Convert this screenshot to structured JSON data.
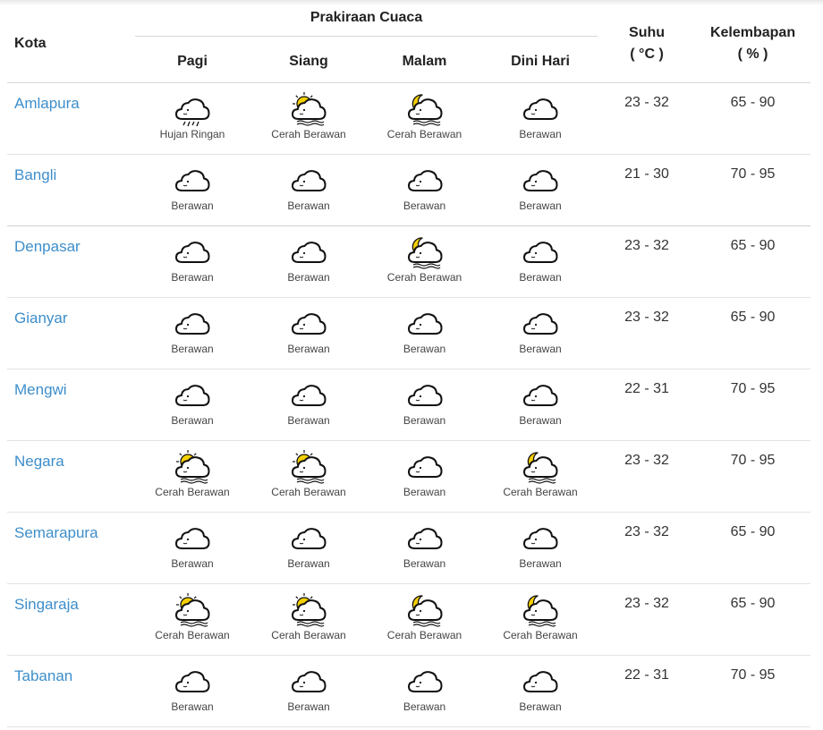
{
  "table": {
    "header": {
      "kota": "Kota",
      "group": "Prakiraan Cuaca",
      "periods": [
        "Pagi",
        "Siang",
        "Malam",
        "Dini Hari"
      ],
      "suhu": "Suhu",
      "suhu_unit": "( °C )",
      "kelembapan": "Kelembapan",
      "kelembapan_unit": "( % )"
    },
    "rows": [
      {
        "city": "Amlapura",
        "weather": [
          {
            "label": "Hujan Ringan",
            "icon": "cloud-rain-icon"
          },
          {
            "label": "Cerah Berawan",
            "icon": "sun-cloud-icon"
          },
          {
            "label": "Cerah Berawan",
            "icon": "moon-cloud-icon"
          },
          {
            "label": "Berawan",
            "icon": "cloud-icon"
          }
        ],
        "suhu": "23 - 32",
        "kelembapan": "65 - 90"
      },
      {
        "city": "Bangli",
        "weather": [
          {
            "label": "Berawan",
            "icon": "cloud-icon"
          },
          {
            "label": "Berawan",
            "icon": "cloud-icon"
          },
          {
            "label": "Berawan",
            "icon": "cloud-icon"
          },
          {
            "label": "Berawan",
            "icon": "cloud-icon"
          }
        ],
        "suhu": "21 - 30",
        "kelembapan": "70 - 95"
      },
      {
        "city": "Denpasar",
        "weather": [
          {
            "label": "Berawan",
            "icon": "cloud-icon"
          },
          {
            "label": "Berawan",
            "icon": "cloud-icon"
          },
          {
            "label": "Cerah Berawan",
            "icon": "moon-cloud-icon"
          },
          {
            "label": "Berawan",
            "icon": "cloud-icon"
          }
        ],
        "suhu": "23 - 32",
        "kelembapan": "65 - 90"
      },
      {
        "city": "Gianyar",
        "weather": [
          {
            "label": "Berawan",
            "icon": "cloud-icon"
          },
          {
            "label": "Berawan",
            "icon": "cloud-icon"
          },
          {
            "label": "Berawan",
            "icon": "cloud-icon"
          },
          {
            "label": "Berawan",
            "icon": "cloud-icon"
          }
        ],
        "suhu": "23 - 32",
        "kelembapan": "65 - 90"
      },
      {
        "city": "Mengwi",
        "weather": [
          {
            "label": "Berawan",
            "icon": "cloud-icon"
          },
          {
            "label": "Berawan",
            "icon": "cloud-icon"
          },
          {
            "label": "Berawan",
            "icon": "cloud-icon"
          },
          {
            "label": "Berawan",
            "icon": "cloud-icon"
          }
        ],
        "suhu": "22 - 31",
        "kelembapan": "70 - 95"
      },
      {
        "city": "Negara",
        "weather": [
          {
            "label": "Cerah Berawan",
            "icon": "sun-cloud-icon"
          },
          {
            "label": "Cerah Berawan",
            "icon": "sun-cloud-icon"
          },
          {
            "label": "Berawan",
            "icon": "cloud-icon"
          },
          {
            "label": "Cerah Berawan",
            "icon": "moon-cloud-icon"
          }
        ],
        "suhu": "23 - 32",
        "kelembapan": "70 - 95"
      },
      {
        "city": "Semarapura",
        "weather": [
          {
            "label": "Berawan",
            "icon": "cloud-icon"
          },
          {
            "label": "Berawan",
            "icon": "cloud-icon"
          },
          {
            "label": "Berawan",
            "icon": "cloud-icon"
          },
          {
            "label": "Berawan",
            "icon": "cloud-icon"
          }
        ],
        "suhu": "23 - 32",
        "kelembapan": "65 - 90"
      },
      {
        "city": "Singaraja",
        "weather": [
          {
            "label": "Cerah Berawan",
            "icon": "sun-cloud-icon"
          },
          {
            "label": "Cerah Berawan",
            "icon": "sun-cloud-icon"
          },
          {
            "label": "Cerah Berawan",
            "icon": "moon-cloud-icon"
          },
          {
            "label": "Cerah Berawan",
            "icon": "moon-cloud-icon"
          }
        ],
        "suhu": "23 - 32",
        "kelembapan": "65 - 90"
      },
      {
        "city": "Tabanan",
        "weather": [
          {
            "label": "Berawan",
            "icon": "cloud-icon"
          },
          {
            "label": "Berawan",
            "icon": "cloud-icon"
          },
          {
            "label": "Berawan",
            "icon": "cloud-icon"
          },
          {
            "label": "Berawan",
            "icon": "cloud-icon"
          }
        ],
        "suhu": "22 - 31",
        "kelembapan": "70 - 95"
      }
    ]
  },
  "colors": {
    "city_link": "#3d8ecb",
    "sun": "#f5d000",
    "cloud_stroke": "#111111"
  }
}
